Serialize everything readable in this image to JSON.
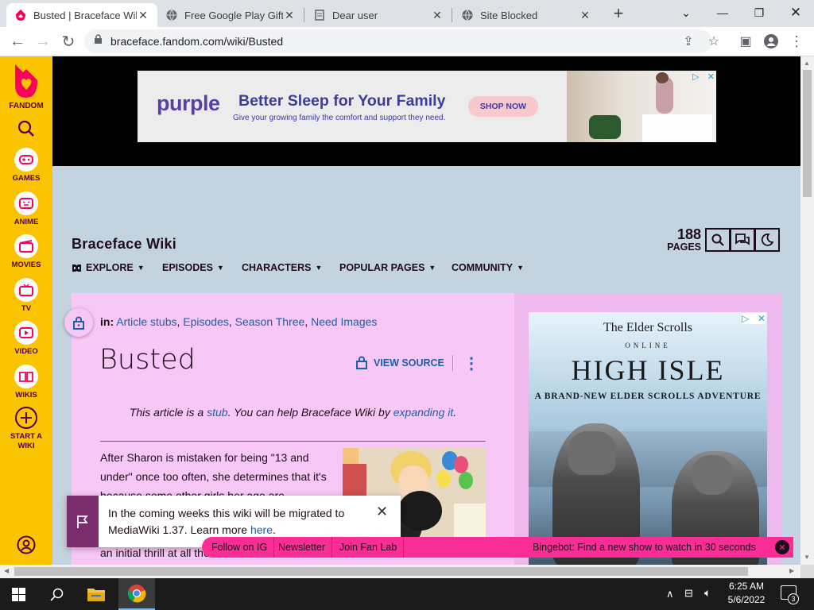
{
  "browser": {
    "tabs": [
      {
        "title": "Busted | Braceface Wiki | Fandom",
        "active": true
      },
      {
        "title": "Free Google Play Gift Card",
        "active": false
      },
      {
        "title": "Dear user",
        "active": false
      },
      {
        "title": "Site Blocked",
        "active": false
      }
    ],
    "new_tab": "+",
    "url": "braceface.fandom.com/wiki/Busted"
  },
  "fandom_sidebar": {
    "logo_label": "FANDOM",
    "items": [
      {
        "label": "GAMES",
        "icon": "games-icon"
      },
      {
        "label": "ANIME",
        "icon": "anime-icon"
      },
      {
        "label": "MOVIES",
        "icon": "movies-icon"
      },
      {
        "label": "TV",
        "icon": "tv-icon"
      },
      {
        "label": "VIDEO",
        "icon": "video-icon"
      },
      {
        "label": "WIKIS",
        "icon": "wikis-icon"
      }
    ],
    "start_wiki": "START A WIKI"
  },
  "top_ad": {
    "brand": "purple",
    "headline": "Better Sleep for Your Family",
    "sub": "Give your growing family the comfort and support they need.",
    "cta": "SHOP NOW"
  },
  "wiki": {
    "name": "Braceface Wiki",
    "pages_count": "188",
    "pages_label": "PAGES",
    "nav": [
      "EXPLORE",
      "EPISODES",
      "CHARACTERS",
      "POPULAR PAGES",
      "COMMUNITY"
    ]
  },
  "article": {
    "in_label": "in:",
    "categories": [
      "Article stubs",
      "Episodes",
      "Season Three",
      "Need Images"
    ],
    "title": "Busted",
    "view_source": "VIEW SOURCE",
    "stub_prefix": "This article is a",
    "stub_link": "stub",
    "stub_mid": ". You can help Braceface Wiki by",
    "stub_link2": "expanding it",
    "stub_end": ".",
    "body": "After Sharon is mistaken for being \"13 and under\" once too often, she determines that it's because some other girls her age are",
    "body_tail": "an initial thrill at all the extra attention. Her"
  },
  "rail_ad": {
    "line1": "The Elder Scrolls",
    "line2": "ONLINE",
    "line3": "HIGH ISLE",
    "line4": "A BRAND-NEW ELDER SCROLLS ADVENTURE"
  },
  "migration_notice": {
    "text": "In the coming weeks this wiki will be migrated to MediaWiki 1.37. Learn more",
    "link": "here",
    "end": "."
  },
  "bottom_bar": {
    "follow": "Follow on IG",
    "newsletter": "Newsletter",
    "fanlab": "Join Fan Lab",
    "bingebot": "Bingebot: Find a new show to watch in 30 seconds"
  },
  "taskbar": {
    "time": "6:25 AM",
    "date": "5/6/2022",
    "notifications": "3"
  },
  "colors": {
    "fandom_yellow": "#fbc401",
    "fandom_pink": "#fa2d97",
    "link_blue": "#1d5fa6",
    "article_bg": "#f7c8f6"
  }
}
